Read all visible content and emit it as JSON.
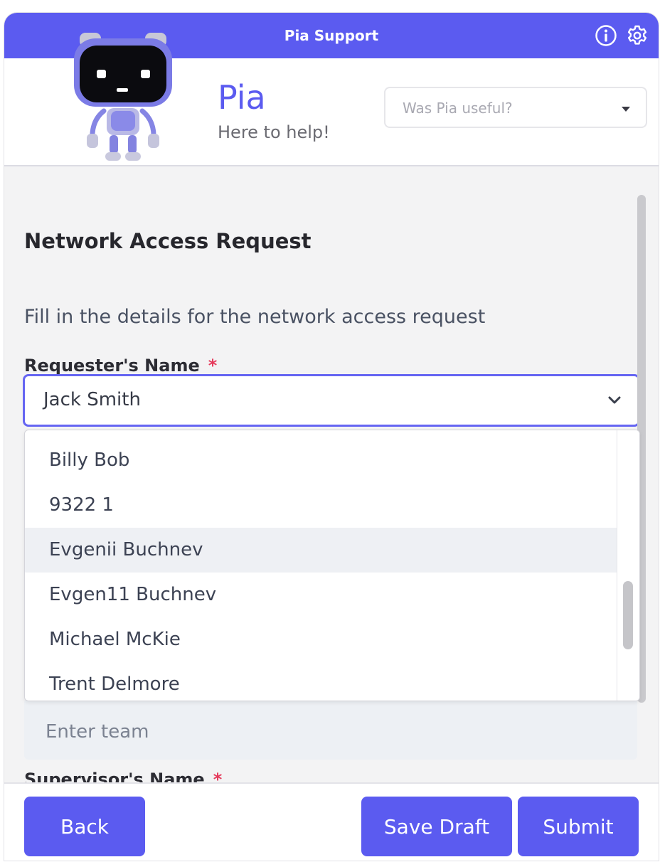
{
  "window": {
    "title": "Pia Support"
  },
  "header": {
    "brand_name": "Pia",
    "tagline": "Here to help!",
    "feedback_placeholder": "Was Pia useful?"
  },
  "form": {
    "title": "Network Access Request",
    "description": "Fill in the details for the network access request",
    "requester_label": "Requester's Name",
    "required_marker": "*",
    "requester_value": "Jack Smith",
    "options": [
      "Billy Bob",
      "9322 1",
      "Evgenii Buchnev",
      "Evgen11 Buchnev",
      "Michael McKie",
      "Trent Delmore"
    ],
    "highlighted_option": "Evgenii Buchnev",
    "team_placeholder": "Enter team",
    "supervisor_label": "Supervisor's Name"
  },
  "footer": {
    "back_label": "Back",
    "save_draft_label": "Save Draft",
    "submit_label": "Submit"
  },
  "colors": {
    "accent": "#5b5bf0",
    "required": "#e53a5b",
    "highlight": "#eef0f4"
  },
  "icons": [
    "info-icon",
    "gear-icon",
    "chevron-down-icon",
    "caret-down-icon",
    "robot-avatar"
  ]
}
